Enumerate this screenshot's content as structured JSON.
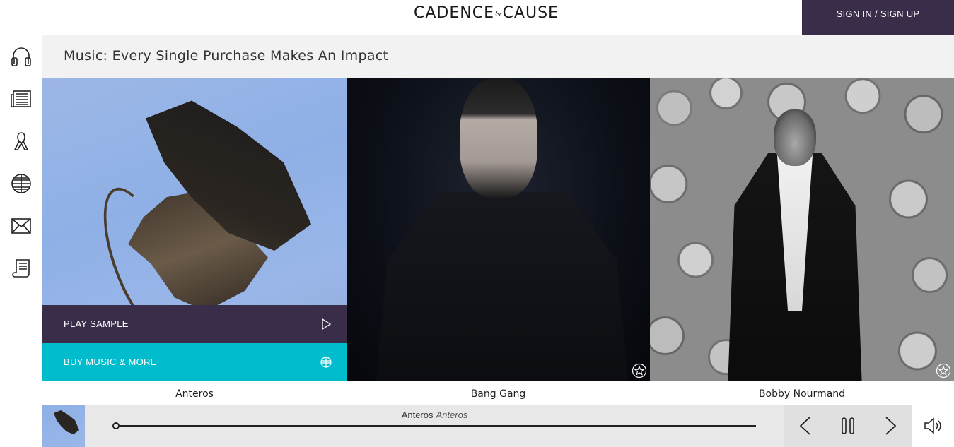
{
  "header": {
    "logo_left": "CADENCE",
    "logo_amp": "&",
    "logo_right": "CAUSE",
    "signin_label": "SIGN IN / SIGN UP"
  },
  "sidebar": {
    "items": [
      {
        "icon": "headphones-icon"
      },
      {
        "icon": "newspaper-icon"
      },
      {
        "icon": "awareness-ribbon-icon"
      },
      {
        "icon": "globe-icon"
      },
      {
        "icon": "envelope-icon"
      },
      {
        "icon": "scroll-icon"
      }
    ]
  },
  "page": {
    "title": "Music: Every Single Purchase Makes An Impact"
  },
  "artists": [
    {
      "name": "Anteros",
      "play_label": "PLAY SAMPLE",
      "buy_label": "BUY MUSIC & MORE"
    },
    {
      "name": "Bang Gang"
    },
    {
      "name": "Bobby Nourmand"
    }
  ],
  "player": {
    "artist": "Anteros",
    "album": "Anteros",
    "progress": 0.0
  },
  "colors": {
    "brand_purple": "#3a2d4a",
    "accent_teal": "#00bccc",
    "title_bar": "#f2f2f2"
  }
}
